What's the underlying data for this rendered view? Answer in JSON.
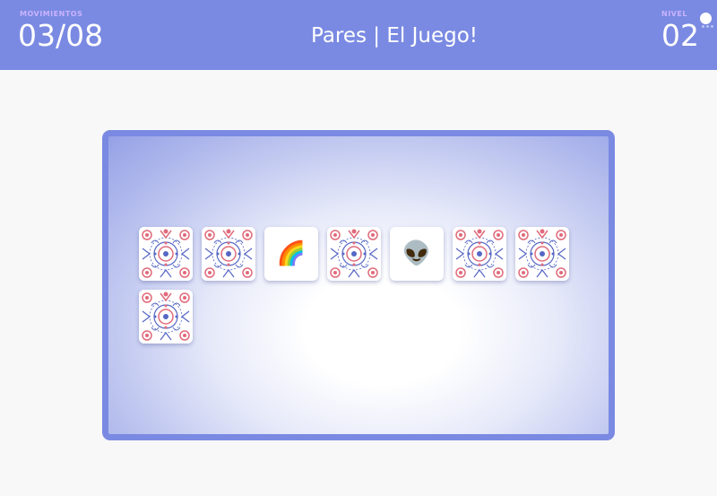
{
  "header": {
    "moves_label": "MOVIMIENTOS",
    "moves_value": "03/08",
    "title": "Pares | El Juego!",
    "level_label": "NIVEL",
    "level_value": "02"
  },
  "colors": {
    "header_bg": "#7a8ae2",
    "label_color": "#c9b3ff",
    "board_border": "#7a8ae2",
    "card_pattern_blue": "#5566c4",
    "card_pattern_red": "#e06a7a"
  },
  "cards": [
    {
      "state": "face-down",
      "icon": "pattern-back"
    },
    {
      "state": "face-down",
      "icon": "pattern-back"
    },
    {
      "state": "face-up",
      "icon": "rainbow-icon",
      "glyph": "🌈"
    },
    {
      "state": "face-down",
      "icon": "pattern-back"
    },
    {
      "state": "face-up",
      "icon": "alien-icon",
      "glyph": "👽"
    },
    {
      "state": "face-down",
      "icon": "pattern-back"
    },
    {
      "state": "face-down",
      "icon": "pattern-back"
    },
    {
      "state": "face-down",
      "icon": "pattern-back"
    }
  ]
}
